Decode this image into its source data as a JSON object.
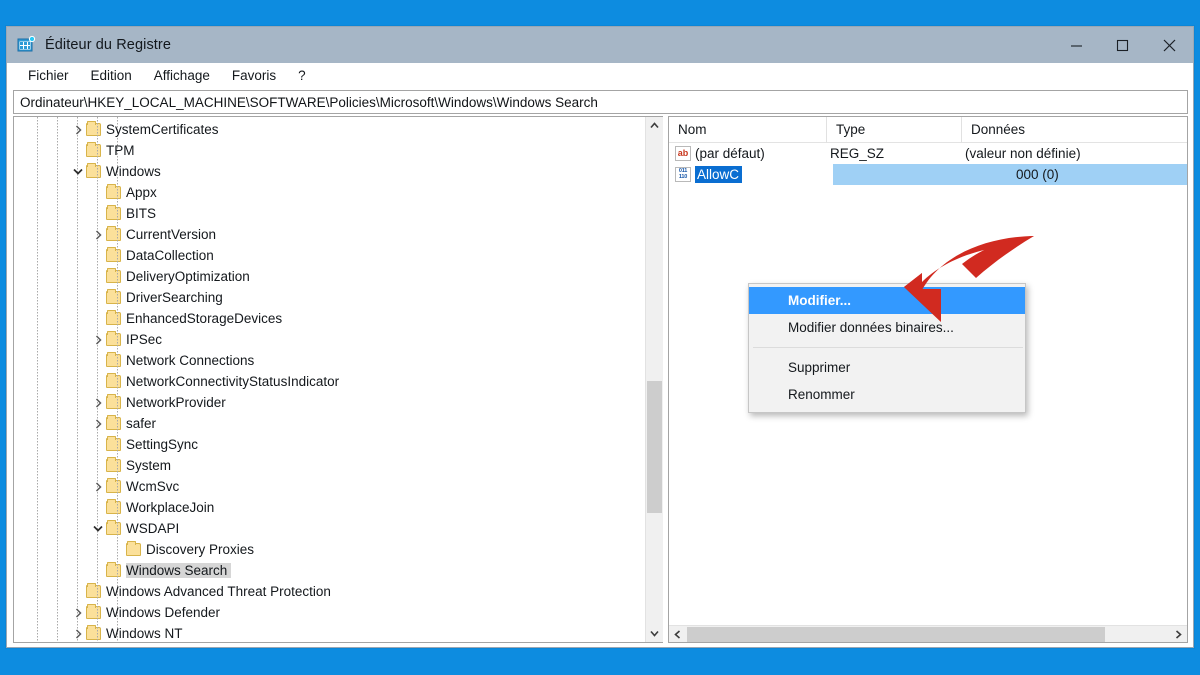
{
  "desktop": {
    "background_color": "#0d8ce0"
  },
  "window": {
    "title": "Éditeur du Registre",
    "icon": "registry-editor-icon",
    "titlebar_color": "#a6b6c6",
    "controls": {
      "minimize": "─",
      "maximize": "□",
      "close": "✕"
    }
  },
  "menubar": {
    "items": [
      {
        "label": "Fichier"
      },
      {
        "label": "Edition"
      },
      {
        "label": "Affichage"
      },
      {
        "label": "Favoris"
      },
      {
        "label": "?"
      }
    ]
  },
  "address_bar": {
    "value": "Ordinateur\\HKEY_LOCAL_MACHINE\\SOFTWARE\\Policies\\Microsoft\\Windows\\Windows Search",
    "placeholder": ""
  },
  "tree": {
    "nodes": [
      {
        "label": "SystemCertificates",
        "depth": 3,
        "twist": "collapsed",
        "selected": false
      },
      {
        "label": "TPM",
        "depth": 3,
        "twist": "none",
        "selected": false
      },
      {
        "label": "Windows",
        "depth": 3,
        "twist": "expanded",
        "selected": false
      },
      {
        "label": "Appx",
        "depth": 4,
        "twist": "none",
        "selected": false
      },
      {
        "label": "BITS",
        "depth": 4,
        "twist": "none",
        "selected": false
      },
      {
        "label": "CurrentVersion",
        "depth": 4,
        "twist": "collapsed",
        "selected": false
      },
      {
        "label": "DataCollection",
        "depth": 4,
        "twist": "none",
        "selected": false
      },
      {
        "label": "DeliveryOptimization",
        "depth": 4,
        "twist": "none",
        "selected": false
      },
      {
        "label": "DriverSearching",
        "depth": 4,
        "twist": "none",
        "selected": false
      },
      {
        "label": "EnhancedStorageDevices",
        "depth": 4,
        "twist": "none",
        "selected": false
      },
      {
        "label": "IPSec",
        "depth": 4,
        "twist": "collapsed",
        "selected": false
      },
      {
        "label": "Network Connections",
        "depth": 4,
        "twist": "none",
        "selected": false
      },
      {
        "label": "NetworkConnectivityStatusIndicator",
        "depth": 4,
        "twist": "none",
        "selected": false
      },
      {
        "label": "NetworkProvider",
        "depth": 4,
        "twist": "collapsed",
        "selected": false
      },
      {
        "label": "safer",
        "depth": 4,
        "twist": "collapsed",
        "selected": false
      },
      {
        "label": "SettingSync",
        "depth": 4,
        "twist": "none",
        "selected": false
      },
      {
        "label": "System",
        "depth": 4,
        "twist": "none",
        "selected": false
      },
      {
        "label": "WcmSvc",
        "depth": 4,
        "twist": "collapsed",
        "selected": false
      },
      {
        "label": "WorkplaceJoin",
        "depth": 4,
        "twist": "none",
        "selected": false
      },
      {
        "label": "WSDAPI",
        "depth": 4,
        "twist": "expanded",
        "selected": false
      },
      {
        "label": "Discovery Proxies",
        "depth": 5,
        "twist": "none",
        "selected": false
      },
      {
        "label": "Windows Search",
        "depth": 4,
        "twist": "none",
        "selected": true
      },
      {
        "label": "Windows Advanced Threat Protection",
        "depth": 3,
        "twist": "none",
        "selected": false
      },
      {
        "label": "Windows Defender",
        "depth": 3,
        "twist": "collapsed",
        "selected": false
      },
      {
        "label": "Windows NT",
        "depth": 3,
        "twist": "collapsed",
        "selected": false
      }
    ]
  },
  "value_list": {
    "columns": [
      {
        "label": "Nom"
      },
      {
        "label": "Type"
      },
      {
        "label": "Données"
      }
    ],
    "rows": [
      {
        "icon": "string-value-icon",
        "icon_text": "ab",
        "name": "(par défaut)",
        "type": "REG_SZ",
        "data": "(valeur non définie)",
        "selected": false
      },
      {
        "icon": "dword-value-icon",
        "icon_text_top": "011",
        "icon_text_bottom": "110",
        "name": "AllowC",
        "type": "",
        "data": "000 (0)",
        "selected": true
      }
    ]
  },
  "context_menu": {
    "items": [
      {
        "label": "Modifier...",
        "highlighted": true,
        "separator_after": false
      },
      {
        "label": "Modifier données binaires...",
        "highlighted": false,
        "separator_after": true
      },
      {
        "label": "Supprimer",
        "highlighted": false,
        "separator_after": false
      },
      {
        "label": "Renommer",
        "highlighted": false,
        "separator_after": false
      }
    ]
  },
  "annotation": {
    "arrow": "red-curved-arrow",
    "color": "#d12a20",
    "points_to": "Modifier..."
  },
  "scrollbars": {
    "tree_vertical": {
      "up": "▲",
      "down": "▼"
    },
    "values_horizontal": {
      "left": "◀",
      "right": "▶"
    }
  }
}
